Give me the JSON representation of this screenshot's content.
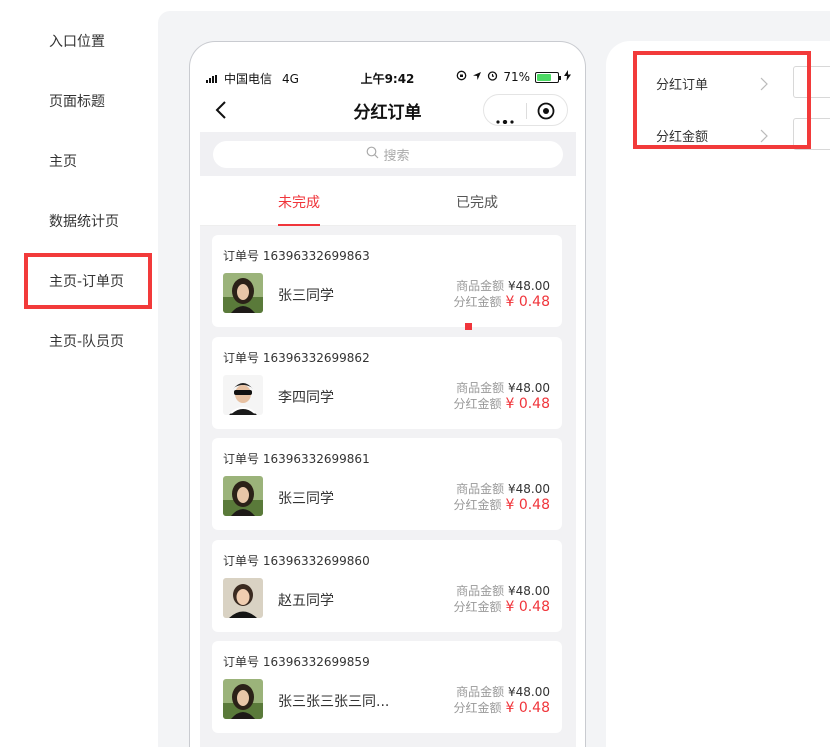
{
  "sidebar": {
    "items": [
      {
        "label": "入口位置"
      },
      {
        "label": "页面标题"
      },
      {
        "label": "主页"
      },
      {
        "label": "数据统计页"
      },
      {
        "label": "主页-订单页"
      },
      {
        "label": "主页-队员页"
      }
    ],
    "selected_index": 4
  },
  "phone": {
    "status": {
      "carrier": "中国电信",
      "network": "4G",
      "time": "上午9:42",
      "battery": "71%",
      "battery_level": 0.71
    },
    "title": "分红订单",
    "search_placeholder": "搜索",
    "tabs": [
      {
        "label": "未完成"
      },
      {
        "label": "已完成"
      }
    ],
    "active_tab": 0,
    "orders": [
      {
        "order_no": "订单号 16396332699863",
        "name": "张三同学",
        "goods_label": "商品金额",
        "goods_amount": "¥48.00",
        "dividend_label": "分红金额",
        "dividend_amount": "¥ 0.48",
        "avatar": "woman-photo-avatar"
      },
      {
        "order_no": "订单号 16396332699862",
        "name": "李四同学",
        "goods_label": "商品金额",
        "goods_amount": "¥48.00",
        "dividend_label": "分红金额",
        "dividend_amount": "¥ 0.48",
        "avatar": "man-photo-avatar"
      },
      {
        "order_no": "订单号 16396332699861",
        "name": "张三同学",
        "goods_label": "商品金额",
        "goods_amount": "¥48.00",
        "dividend_label": "分红金额",
        "dividend_amount": "¥ 0.48",
        "avatar": "woman-photo-avatar"
      },
      {
        "order_no": "订单号 16396332699860",
        "name": "赵五同学",
        "goods_label": "商品金额",
        "goods_amount": "¥48.00",
        "dividend_label": "分红金额",
        "dividend_amount": "¥ 0.48",
        "avatar": "woman2-photo-avatar"
      },
      {
        "order_no": "订单号 16396332699859",
        "name": "张三张三张三同...",
        "goods_label": "商品金额",
        "goods_amount": "¥48.00",
        "dividend_label": "分红金额",
        "dividend_amount": "¥ 0.48",
        "avatar": "woman-photo-avatar"
      }
    ]
  },
  "panel": {
    "rows": [
      {
        "label": "分红订单"
      },
      {
        "label": "分红金额"
      }
    ]
  },
  "colors": {
    "accent": "#f0353b",
    "highlight": "#f23a3a",
    "canvas": "#f3f4f6"
  }
}
